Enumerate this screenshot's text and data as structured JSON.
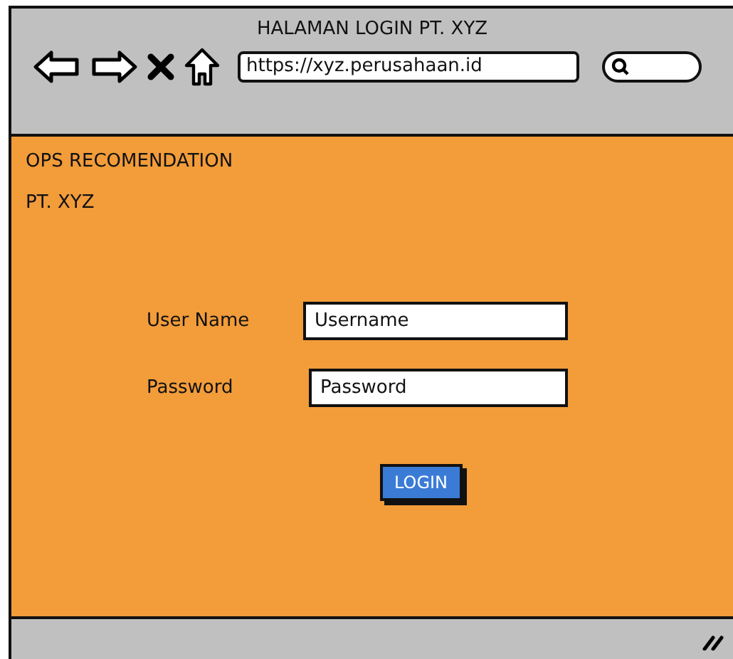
{
  "window": {
    "title": "HALAMAN LOGIN PT. XYZ"
  },
  "address_bar": {
    "value": "https://xyz.perusahaan.id"
  },
  "page": {
    "heading": "OPS RECOMENDATION",
    "subheading": "PT. XYZ"
  },
  "form": {
    "fields": [
      {
        "label": "User Name",
        "value": "Username"
      },
      {
        "label": "Password",
        "value": "Password"
      }
    ],
    "button": "LOGIN"
  }
}
